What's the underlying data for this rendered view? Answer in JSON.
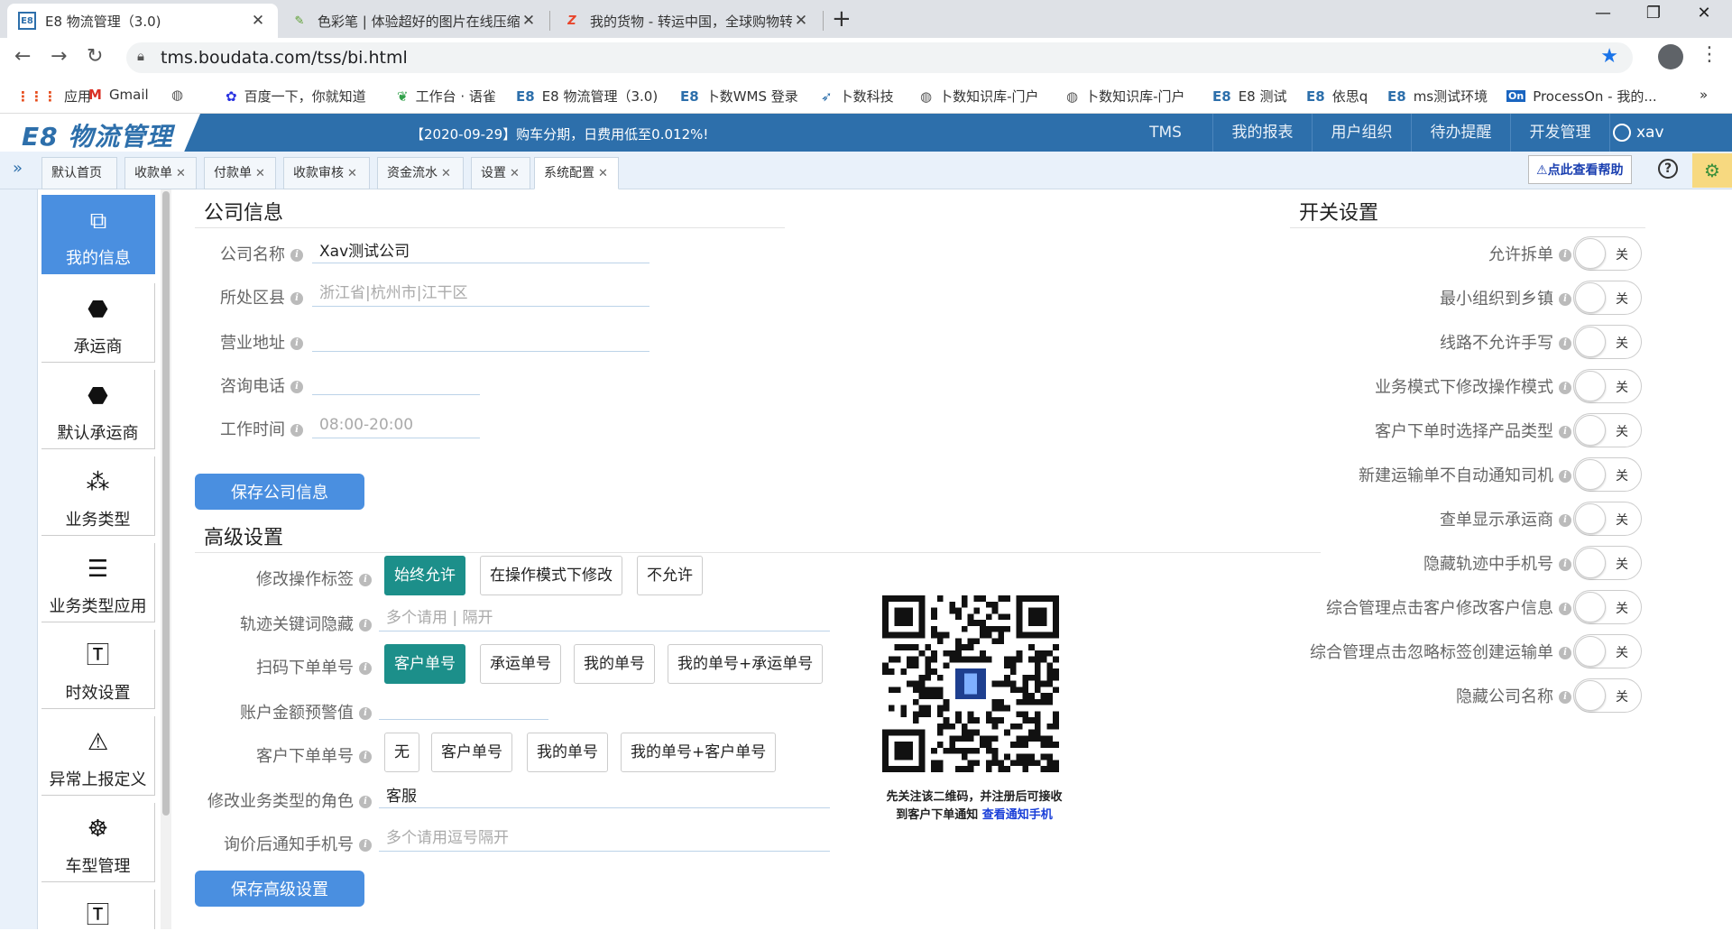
{
  "browser": {
    "tabs": [
      {
        "label": "E8 物流管理（3.0)",
        "icon": "e8-icon"
      },
      {
        "label": "色彩笔 | 体验超好的图片在线压缩",
        "icon": "pen-icon"
      },
      {
        "label": "我的货物 - 转运中国，全球购物转",
        "icon": "z-icon"
      }
    ],
    "url": "tms.boudata.com/tss/bi.html",
    "bookmarks": [
      {
        "label": "应用",
        "icon": "apps-icon"
      },
      {
        "label": "Gmail",
        "icon": "gmail-icon"
      },
      {
        "label": "",
        "icon": "globe-icon"
      },
      {
        "label": "百度一下，你就知道",
        "icon": "paw-icon"
      },
      {
        "label": "工作台 · 语雀",
        "icon": "leaf-icon"
      },
      {
        "label": "E8 物流管理（3.0)",
        "icon": "e8-icon"
      },
      {
        "label": "卜数WMS 登录",
        "icon": "e8-icon"
      },
      {
        "label": "卜数科技",
        "icon": "bird-icon"
      },
      {
        "label": "卜数知识库-门户",
        "icon": "globe-icon"
      },
      {
        "label": "卜数知识库-门户",
        "icon": "globe-icon"
      },
      {
        "label": "E8 测试",
        "icon": "e8-icon"
      },
      {
        "label": "依思q",
        "icon": "e8-icon"
      },
      {
        "label": "ms测试环境",
        "icon": "e8-icon"
      },
      {
        "label": "ProcessOn - 我的...",
        "icon": "on-icon"
      }
    ],
    "more_bookmarks": "»"
  },
  "app": {
    "logo_text": "E8 物流管理",
    "announcement": "【2020-09-29】购车分期，日费用低至0.012%!",
    "nav": [
      "TMS",
      "我的报表",
      "用户组织",
      "待办提醒",
      "开发管理"
    ],
    "user": "xav",
    "help_link": "点此查看帮助",
    "page_tabs": [
      {
        "label": "默认首页",
        "closable": false
      },
      {
        "label": "收款单",
        "closable": true
      },
      {
        "label": "付款单",
        "closable": true
      },
      {
        "label": "收款审核",
        "closable": true
      },
      {
        "label": "资金流水",
        "closable": true
      },
      {
        "label": "设置",
        "closable": true
      },
      {
        "label": "系统配置",
        "closable": true
      }
    ],
    "sidebar": [
      {
        "label": "我的信息",
        "icon": "profile-card-icon"
      },
      {
        "label": "承运商",
        "icon": "carrier-badge-icon"
      },
      {
        "label": "默认承运商",
        "icon": "carrier-badge-icon"
      },
      {
        "label": "业务类型",
        "icon": "nodes-icon"
      },
      {
        "label": "业务类型应用",
        "icon": "list-icon"
      },
      {
        "label": "时效设置",
        "icon": "t-box-icon"
      },
      {
        "label": "异常上报定义",
        "icon": "warning-icon"
      },
      {
        "label": "车型管理",
        "icon": "steering-wheel-icon"
      },
      {
        "label": "",
        "icon": "t-box-icon"
      }
    ]
  },
  "company": {
    "title": "公司信息",
    "fields": [
      {
        "label": "公司名称",
        "value": "Xav测试公司",
        "placeholder": ""
      },
      {
        "label": "所处区县",
        "value": "",
        "placeholder": "浙江省|杭州市|江干区"
      },
      {
        "label": "营业地址",
        "value": "",
        "placeholder": ""
      },
      {
        "label": "咨询电话",
        "value": "",
        "placeholder": ""
      },
      {
        "label": "工作时间",
        "value": "",
        "placeholder": "08:00-20:00"
      }
    ],
    "save_label": "保存公司信息"
  },
  "advanced": {
    "title": "高级设置",
    "modify_tag": {
      "label": "修改操作标签",
      "options": [
        "始终允许",
        "在操作模式下修改",
        "不允许"
      ],
      "selected": "始终允许"
    },
    "hide_keywords": {
      "label": "轨迹关键词隐藏",
      "placeholder": "多个请用 | 隔开"
    },
    "scan_order": {
      "label": "扫码下单单号",
      "options": [
        "客户单号",
        "承运单号",
        "我的单号",
        "我的单号+承运单号"
      ],
      "selected": "客户单号"
    },
    "balance_warning": {
      "label": "账户金额预警值",
      "value": ""
    },
    "customer_order": {
      "label": "客户下单单号",
      "options": [
        "无",
        "客户单号",
        "我的单号",
        "我的单号+客户单号"
      ],
      "selected": ""
    },
    "modify_role": {
      "label": "修改业务类型的角色",
      "value": "客服"
    },
    "notify_phone": {
      "label": "询价后通知手机号",
      "placeholder": "多个请用逗号隔开"
    },
    "save_label": "保存高级设置",
    "qr_caption_line1": "先关注该二维码，并注册后可接收",
    "qr_caption_line2": "到客户下单通知",
    "qr_link": "查看通知手机"
  },
  "switches": {
    "title": "开关设置",
    "off_label": "关",
    "items": [
      "允许拆单",
      "最小组织到乡镇",
      "线路不允许手写",
      "业务模式下修改操作模式",
      "客户下单时选择产品类型",
      "新建运输单不自动通知司机",
      "查单显示承运商",
      "隐藏轨迹中手机号",
      "综合管理点击客户修改客户信息",
      "综合管理点击忽略标签创建运输单",
      "隐藏公司名称"
    ]
  },
  "colors": {
    "header_blue": "#2d6fab",
    "primary_button": "#4a8fe0",
    "selected_teal": "#1c8f8a"
  }
}
